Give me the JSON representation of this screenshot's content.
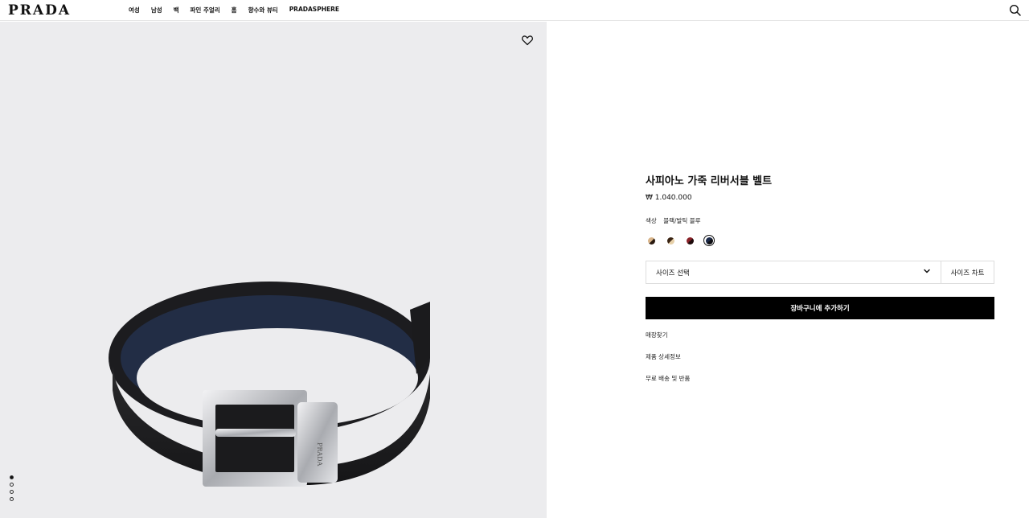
{
  "header": {
    "logo": "PRADA",
    "nav": [
      "여성",
      "남성",
      "백",
      "파인 주얼리",
      "홈",
      "향수와 뷰티",
      "PRADASPHERE"
    ]
  },
  "icons": {
    "search": "search-icon",
    "wishlist": "heart-icon",
    "dropdown": "chevron-down-icon"
  },
  "product": {
    "title": "사피아노 가죽 리버서블 벨트",
    "price": "₩ 1.040.000",
    "color_label": "색상",
    "color_value": "블랙/발틱 블루",
    "swatches": [
      {
        "name": "brown-tan",
        "colors": [
          "#5a3a22",
          "#d8b48a"
        ]
      },
      {
        "name": "brown-cream",
        "colors": [
          "#4a3020",
          "#e6cfa8"
        ]
      },
      {
        "name": "dark-red",
        "colors": [
          "#3a0e10",
          "#8a2228"
        ]
      },
      {
        "name": "black-blue",
        "colors": [
          "#0d0d12",
          "#1c2a4a"
        ],
        "selected": true
      }
    ],
    "size_placeholder": "사이즈 선택",
    "size_chart": "사이즈 차트",
    "add_to_cart": "장바구니에 추가하기",
    "links": [
      "매장찾기",
      "제품 상세정보",
      "무료 배송 및 반품"
    ]
  },
  "gallery": {
    "image_count": 4,
    "active_index": 0,
    "background": "#ececee"
  }
}
